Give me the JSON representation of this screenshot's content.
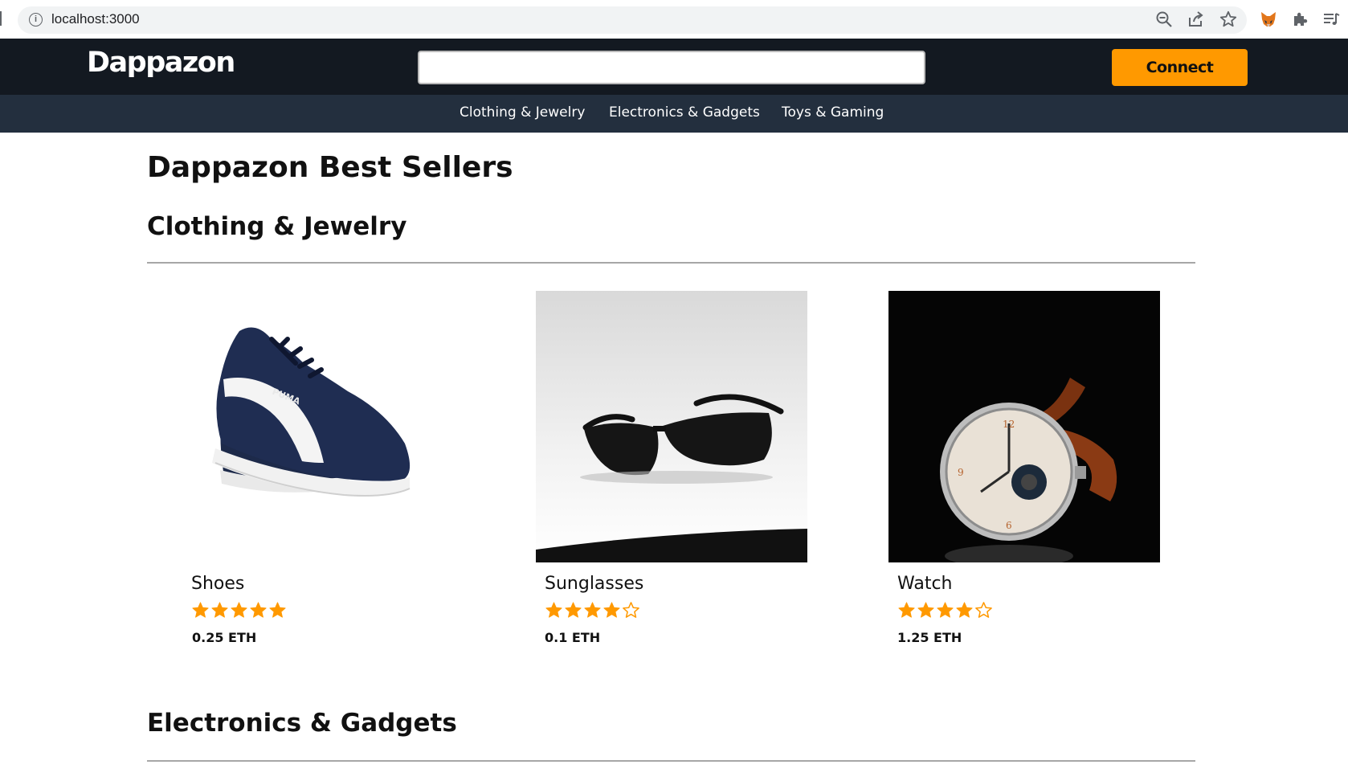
{
  "browser": {
    "url": "localhost:3000"
  },
  "header": {
    "logo": "Dappazon",
    "search_placeholder": "",
    "connect_label": "Connect"
  },
  "nav": {
    "categories": [
      "Clothing & Jewelry",
      "Electronics & Gadgets",
      "Toys & Gaming"
    ]
  },
  "main": {
    "title": "Dappazon Best Sellers",
    "sections": [
      {
        "title": "Clothing & Jewelry",
        "products": [
          {
            "name": "Shoes",
            "rating": 5,
            "price": "0.25 ETH"
          },
          {
            "name": "Sunglasses",
            "rating": 4,
            "price": "0.1 ETH"
          },
          {
            "name": "Watch",
            "rating": 4,
            "price": "1.25 ETH"
          }
        ]
      },
      {
        "title": "Electronics & Gadgets",
        "products": []
      }
    ]
  },
  "colors": {
    "header_bg": "#131921",
    "nav_bg": "#232f3e",
    "accent": "#ff9900",
    "star": "#ff9900"
  }
}
